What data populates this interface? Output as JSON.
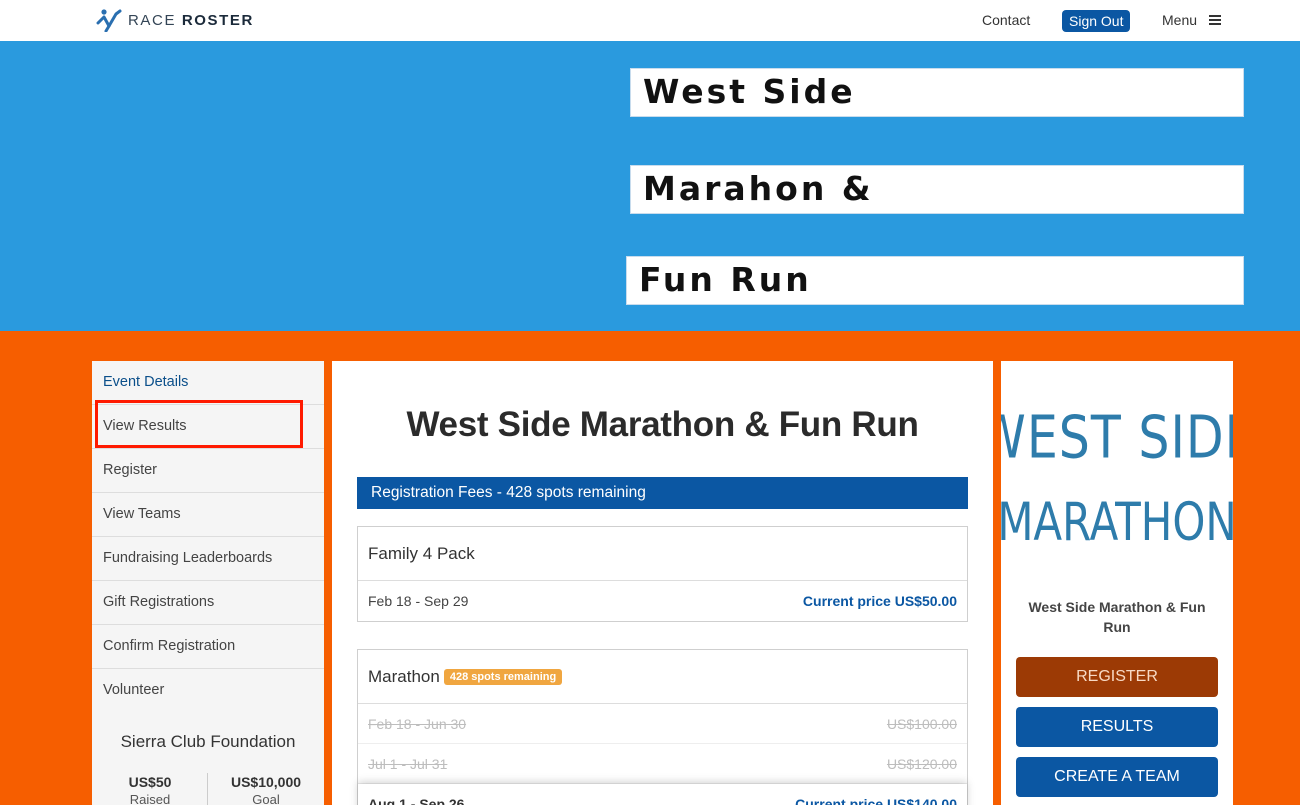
{
  "brand": {
    "name_light": "RACE",
    "name_bold": "ROSTER",
    "accent": "#0b57a3"
  },
  "nav": {
    "contact": "Contact",
    "sign_out": "Sign Out",
    "menu": "Menu"
  },
  "banner": {
    "lines": [
      "West Side",
      "Marahon &",
      "Fun Run"
    ],
    "background": "#2a9ade"
  },
  "sidebar": {
    "items": [
      {
        "label": "Event Details"
      },
      {
        "label": "View Results"
      },
      {
        "label": "Register"
      },
      {
        "label": "View Teams"
      },
      {
        "label": "Fundraising Leaderboards"
      },
      {
        "label": "Gift Registrations"
      },
      {
        "label": "Confirm Registration"
      },
      {
        "label": "Volunteer"
      }
    ],
    "charity": {
      "name": "Sierra Club Foundation",
      "raised_value": "US$50",
      "raised_label": "Raised",
      "goal_value": "US$10,000",
      "goal_label": "Goal"
    }
  },
  "main": {
    "title": "West Side Marathon & Fun Run",
    "fees_header": "Registration Fees - 428 spots remaining",
    "cards": [
      {
        "name": "Family 4 Pack",
        "rows": [
          {
            "dates": "Feb 18 - Sep 29",
            "price": "Current price US$50.00"
          }
        ]
      },
      {
        "name": "Marathon",
        "badge": "428 spots remaining",
        "rows": [
          {
            "dates": "Feb 18 - Jun 30",
            "price": "US$100.00"
          },
          {
            "dates": "Jul 1 - Jul 31",
            "price": "US$120.00"
          },
          {
            "dates": "Aug 1 - Sep 26",
            "price": "Current price US$140.00"
          }
        ]
      }
    ]
  },
  "right": {
    "logo_lines": [
      "WEST SIDE",
      "MARATHON"
    ],
    "event_name": "West Side Marathon & Fun Run",
    "register": "REGISTER",
    "results": "RESULTS",
    "create_team": "CREATE A TEAM"
  },
  "colors": {
    "page_background": "#f65e00",
    "highlight": "#ff1a00",
    "badge": "#f0a640",
    "register_button": "#9c3a05"
  }
}
